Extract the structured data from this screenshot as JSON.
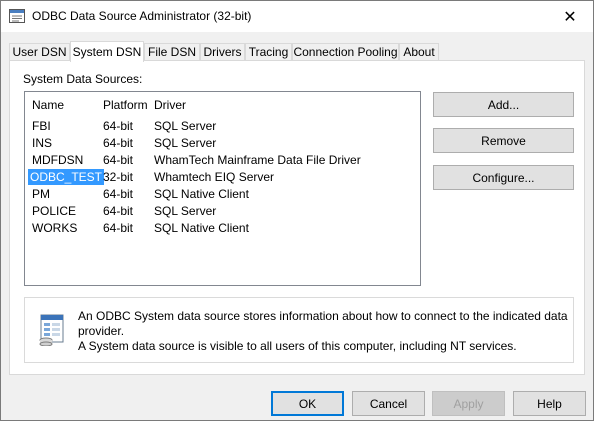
{
  "window": {
    "title": "ODBC Data Source Administrator (32-bit)",
    "close_glyph": "✕"
  },
  "tabs": [
    {
      "label": "User DSN"
    },
    {
      "label": "System DSN"
    },
    {
      "label": "File DSN"
    },
    {
      "label": "Drivers"
    },
    {
      "label": "Tracing"
    },
    {
      "label": "Connection Pooling"
    },
    {
      "label": "About"
    }
  ],
  "active_tab": "System DSN",
  "panel": {
    "section_label": "System Data Sources:",
    "columns": {
      "name": "Name",
      "platform": "Platform",
      "driver": "Driver"
    },
    "rows": [
      {
        "name": "FBI",
        "platform": "64-bit",
        "driver": "SQL Server"
      },
      {
        "name": "INS",
        "platform": "64-bit",
        "driver": "SQL Server"
      },
      {
        "name": "MDFDSN",
        "platform": "64-bit",
        "driver": "WhamTech Mainframe Data File Driver"
      },
      {
        "name": "ODBC_TEST",
        "platform": "32-bit",
        "driver": "Whamtech EIQ Server"
      },
      {
        "name": "PM",
        "platform": "64-bit",
        "driver": "SQL Native Client"
      },
      {
        "name": "POLICE",
        "platform": "64-bit",
        "driver": "SQL Server"
      },
      {
        "name": "WORKS",
        "platform": "64-bit",
        "driver": "SQL Native Client"
      }
    ],
    "selected_row": "ODBC_TEST",
    "buttons": {
      "add": "Add...",
      "remove": "Remove",
      "configure": "Configure..."
    },
    "info_line1": "An ODBC System data source stores information about how to connect to the indicated data provider.",
    "info_line2": "A System data source is visible to all users of this computer, including NT services."
  },
  "footer": {
    "ok": "OK",
    "cancel": "Cancel",
    "apply": "Apply",
    "help": "Help"
  },
  "colors": {
    "selection": "#3399ff",
    "default_button_border": "#0078d7"
  },
  "icons": {
    "title": "odbc-app-icon",
    "info": "database-document-icon",
    "close": "close-icon"
  }
}
